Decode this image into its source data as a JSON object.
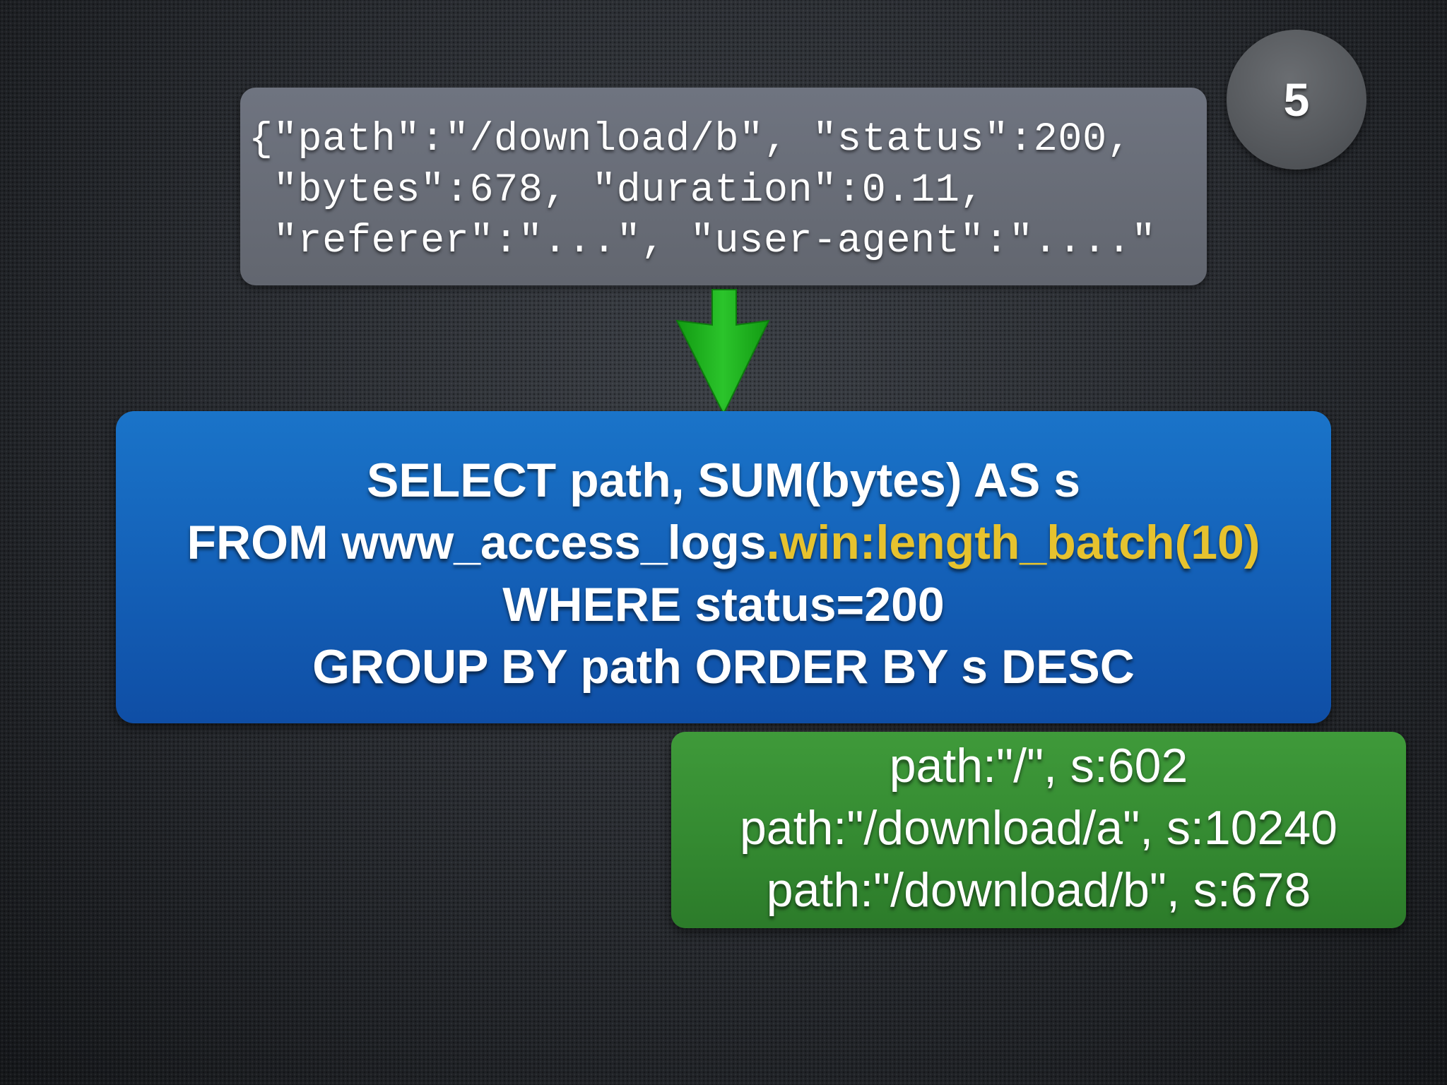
{
  "slide": {
    "number": "5"
  },
  "event": {
    "lines": [
      "{\"path\":\"/download/b\", \"status\":200,",
      " \"bytes\":678, \"duration\":0.11,",
      " \"referer\":\"...\", \"user-agent\":\"....\""
    ]
  },
  "query": {
    "line1": "SELECT path, SUM(bytes) AS s",
    "line2_prefix": "FROM www_access_logs",
    "line2_highlight": ".win:length_batch(10)",
    "line3": "WHERE status=200",
    "line4": "GROUP BY path ORDER BY s DESC",
    "highlight_color": "#e6c22e"
  },
  "results": {
    "rows": [
      "path:\"/\", s:602",
      "path:\"/download/a\", s:10240",
      "path:\"/download/b\", s:678"
    ]
  },
  "colors": {
    "arrow": "#1fb51f",
    "query_box": "#1461b8",
    "result_box": "#348a31",
    "event_box": "#686c76"
  }
}
